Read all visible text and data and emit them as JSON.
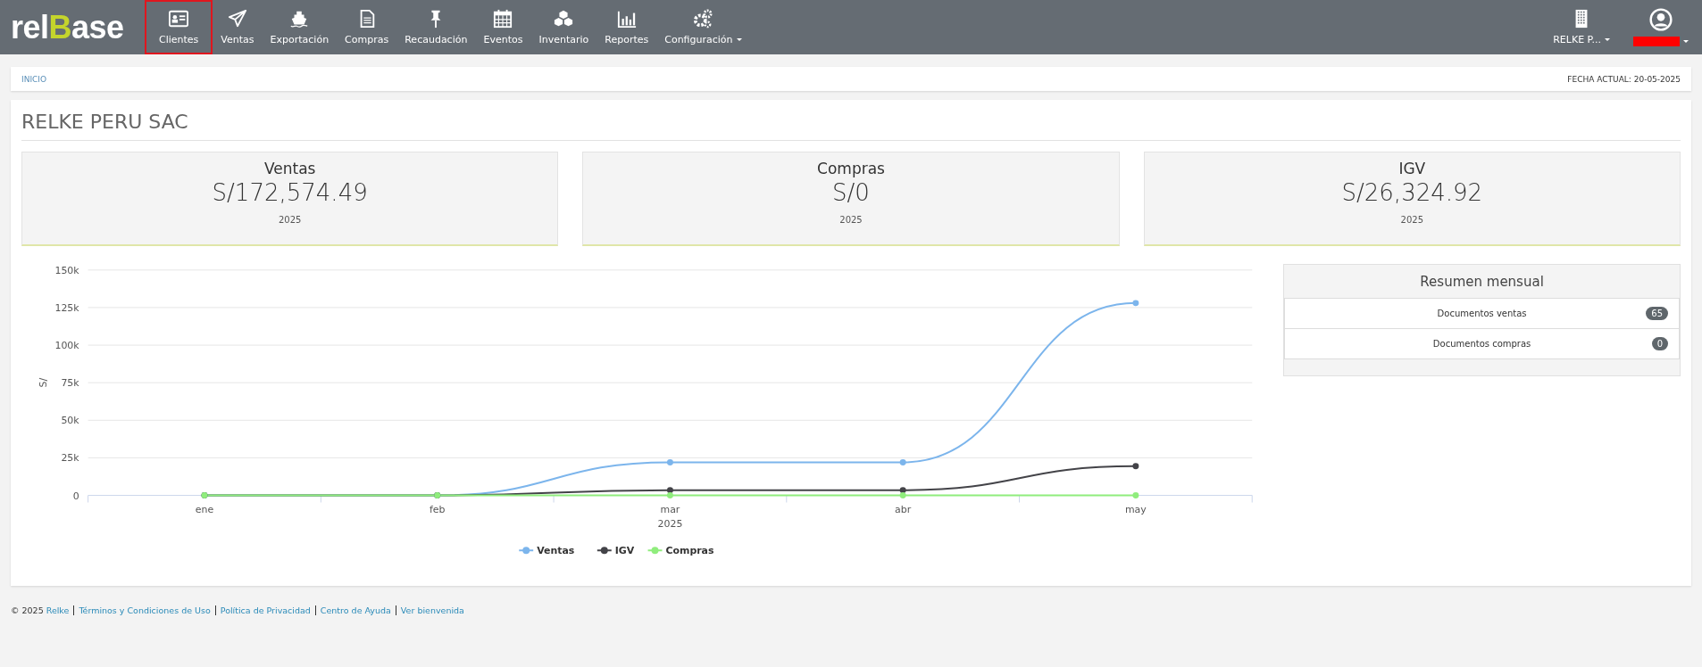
{
  "logo": {
    "parts": [
      {
        "text": "rel",
        "accent": false
      },
      {
        "text": "B",
        "accent": true
      },
      {
        "text": "ase",
        "accent": false
      }
    ]
  },
  "nav": [
    {
      "label": "Clientes",
      "highlighted": true,
      "dropdown": false
    },
    {
      "label": "Ventas",
      "highlighted": false,
      "dropdown": false
    },
    {
      "label": "Exportación",
      "highlighted": false,
      "dropdown": false
    },
    {
      "label": "Compras",
      "highlighted": false,
      "dropdown": false
    },
    {
      "label": "Recaudación",
      "highlighted": false,
      "dropdown": false
    },
    {
      "label": "Eventos",
      "highlighted": false,
      "dropdown": false
    },
    {
      "label": "Inventario",
      "highlighted": false,
      "dropdown": false
    },
    {
      "label": "Reportes",
      "highlighted": false,
      "dropdown": false
    },
    {
      "label": "Configuración",
      "highlighted": false,
      "dropdown": true
    }
  ],
  "company_menu": {
    "label": "RELKE P...",
    "dropdown": true
  },
  "user_menu": {
    "name_redacted": true,
    "dropdown": true
  },
  "breadcrumb": {
    "label": "INICIO"
  },
  "current_date": "FECHA ACTUAL: 20-05-2025",
  "page_title": "RELKE PERU SAC",
  "cards": [
    {
      "title": "Ventas",
      "value": "S/172,574.49",
      "period": "2025"
    },
    {
      "title": "Compras",
      "value": "S/0",
      "period": "2025"
    },
    {
      "title": "IGV",
      "value": "S/26,324.92",
      "period": "2025"
    }
  ],
  "chart": {
    "chart_data": {
      "type": "line",
      "grid": true,
      "legend": true,
      "xlabel": "2025",
      "ylabel": "S/",
      "categories": [
        "ene",
        "feb",
        "mar",
        "abr",
        "may"
      ],
      "ylim": [
        0,
        150000
      ],
      "yticks": [
        {
          "value": 0,
          "label": "0"
        },
        {
          "value": 25000,
          "label": "25k"
        },
        {
          "value": 50000,
          "label": "50k"
        },
        {
          "value": 75000,
          "label": "75k"
        },
        {
          "value": 100000,
          "label": "100k"
        },
        {
          "value": 125000,
          "label": "125k"
        },
        {
          "value": 150000,
          "label": "150k"
        }
      ],
      "series": [
        {
          "name": "Ventas",
          "color": "#7cb5ec",
          "marker": true,
          "values": [
            0,
            0,
            22000,
            22000,
            128000
          ]
        },
        {
          "name": "IGV",
          "color": "#434348",
          "marker": true,
          "values": [
            0,
            0,
            3500,
            3500,
            19500
          ]
        },
        {
          "name": "Compras",
          "color": "#90ed7d",
          "marker": true,
          "values": [
            0,
            0,
            0,
            0,
            0
          ]
        }
      ]
    }
  },
  "summary": {
    "title": "Resumen mensual",
    "rows": [
      {
        "label": "Documentos ventas",
        "count": "65"
      },
      {
        "label": "Documentos compras",
        "count": "0"
      }
    ]
  },
  "footer": {
    "copyright": "© 2025",
    "links": [
      "Relke",
      "Términos y Condiciones de Uso",
      "Política de Privacidad",
      "Centro de Ayuda",
      "Ver bienvenida"
    ]
  }
}
